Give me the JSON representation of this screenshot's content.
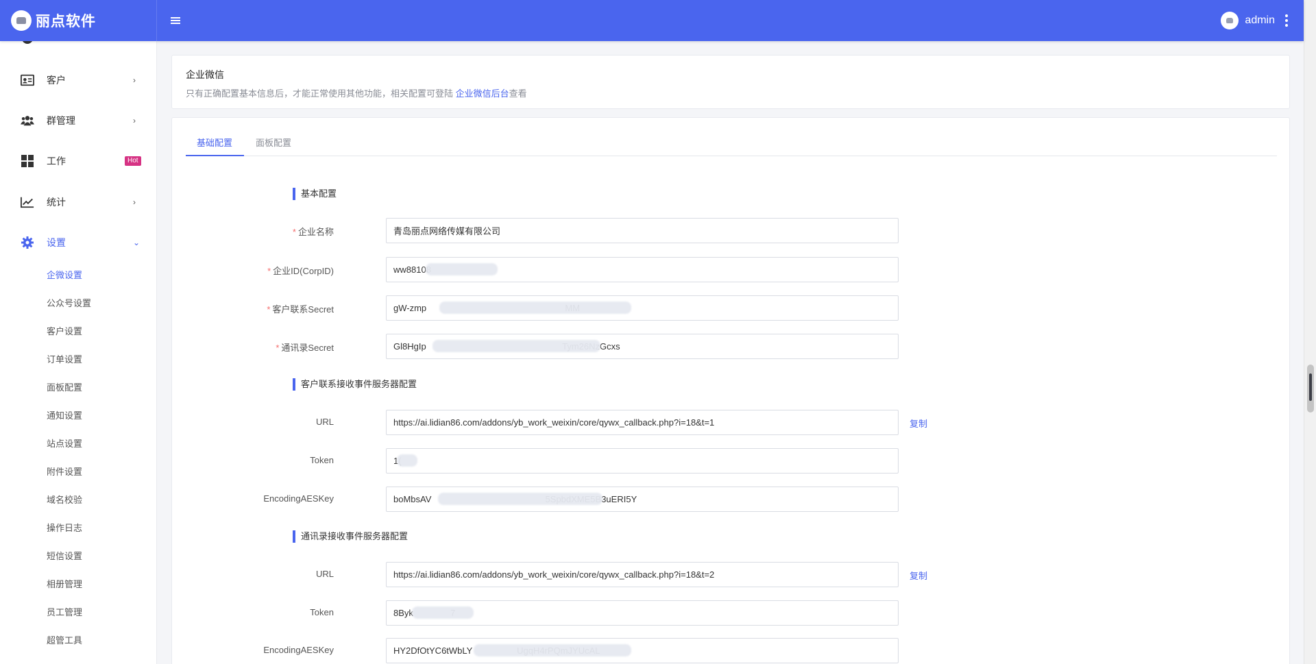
{
  "header": {
    "brand": "丽点软件",
    "menu_icon": "hamburger-icon",
    "user": "admin"
  },
  "sidebar": {
    "items": [
      {
        "label": "客户",
        "icon": "contact-card-icon"
      },
      {
        "label": "群管理",
        "icon": "users-icon"
      },
      {
        "label": "工作",
        "icon": "grid-icon",
        "badge": "Hot"
      },
      {
        "label": "统计",
        "icon": "trend-chart-icon"
      },
      {
        "label": "设置",
        "icon": "gear-icon"
      }
    ],
    "sub_items": [
      "企微设置",
      "公众号设置",
      "客户设置",
      "订单设置",
      "面板配置",
      "通知设置",
      "站点设置",
      "附件设置",
      "域名校验",
      "操作日志",
      "短信设置",
      "相册管理",
      "员工管理",
      "超管工具"
    ]
  },
  "info_card": {
    "title": "企业微信",
    "desc_prefix": "只有正确配置基本信息后，才能正常使用其他功能，相关配置可登陆 ",
    "desc_link": "企业微信后台",
    "desc_suffix": "查看"
  },
  "tabs": [
    "基础配置",
    "面板配置"
  ],
  "sections": {
    "basic": "基本配置",
    "contact_server": "客户联系接收事件服务器配置",
    "address_server": "通讯录接收事件服务器配置"
  },
  "fields": {
    "corp_name": {
      "label": "企业名称",
      "value": "青岛丽点网络传媒有限公司"
    },
    "corp_id": {
      "label": "企业ID(CorpID)",
      "value": "ww88108"
    },
    "contact_secret": {
      "label": "客户联系Secret",
      "value": "gW-zmp                                                        MM"
    },
    "address_secret": {
      "label": "通讯录Secret",
      "value": "Gl8HgIp                                                       Tym26NzGcxs"
    },
    "contact_url": {
      "label": "URL",
      "value": "https://ai.lidian86.com/addons/yb_work_weixin/core/qywx_callback.php?i=18&t=1"
    },
    "contact_token": {
      "label": "Token",
      "value": "1("
    },
    "contact_aes": {
      "label": "EncodingAESKey",
      "value": "boMbsAV                                              5SpbdXME5B3uERI5Y"
    },
    "address_url": {
      "label": "URL",
      "value": "https://ai.lidian86.com/addons/yb_work_weixin/core/qywx_callback.php?i=18&t=2"
    },
    "address_token": {
      "label": "Token",
      "value": "8Byk               7"
    },
    "address_aes": {
      "label": "EncodingAESKey",
      "value": "HY2DfOtYC6tWbLY                  UgqH4rPQmJYUcAL"
    }
  },
  "copy_label": "复制",
  "colors": {
    "primary": "#4a65ee",
    "hot": "#d63384",
    "required": "#f56c6c"
  }
}
